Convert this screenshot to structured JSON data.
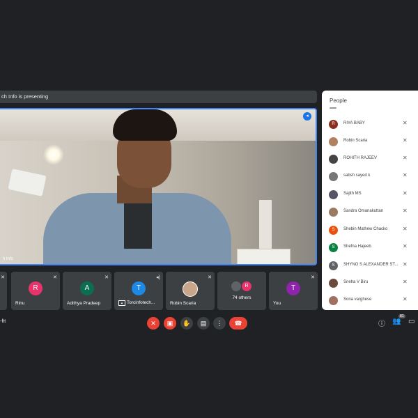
{
  "presenting": {
    "text": "ch Info is presenting"
  },
  "main_video": {
    "name": "h Info"
  },
  "tiles": [
    {
      "name": "Rinu",
      "initial": "R",
      "color": "#e8336d"
    },
    {
      "name": "Adithya Pradeep",
      "initial": "A",
      "color": "#0b6e4f"
    },
    {
      "name": "Torcinfotech...",
      "initial": "T",
      "color": "#1e88e5"
    },
    {
      "name": "Robin Scaria",
      "initial": ""
    },
    {
      "name": "74 others",
      "initial": "R"
    },
    {
      "name": "You",
      "initial": "T",
      "color": "#8e24aa"
    }
  ],
  "people": {
    "title": "People",
    "items": [
      {
        "name": "RIYA BABY",
        "initial": "R",
        "color": "#8a2f1e"
      },
      {
        "name": "Robin Scaria",
        "initial": "",
        "color": "#b08060"
      },
      {
        "name": "ROHITH RAJEEV",
        "initial": "",
        "color": "#444"
      },
      {
        "name": "sabsh sayed k",
        "initial": "",
        "color": "#777"
      },
      {
        "name": "Sajith MS",
        "initial": "",
        "color": "#556"
      },
      {
        "name": "Sandra Omanakuttan",
        "initial": "",
        "color": "#9a7a60"
      },
      {
        "name": "Shebin Mathew Chacko",
        "initial": "S",
        "color": "#e8510f"
      },
      {
        "name": "Shefna Hajeeb",
        "initial": "S",
        "color": "#0b8043"
      },
      {
        "name": "SHYNO S ALEXANDER ST...",
        "initial": "S",
        "color": "#5f6368"
      },
      {
        "name": "Sneha V Biru",
        "initial": "",
        "color": "#6a4a3a"
      },
      {
        "name": "Sona varghese",
        "initial": "",
        "color": "#a07060"
      }
    ]
  },
  "bottom": {
    "meeting_code": "-ftt",
    "participant_count": "81"
  }
}
